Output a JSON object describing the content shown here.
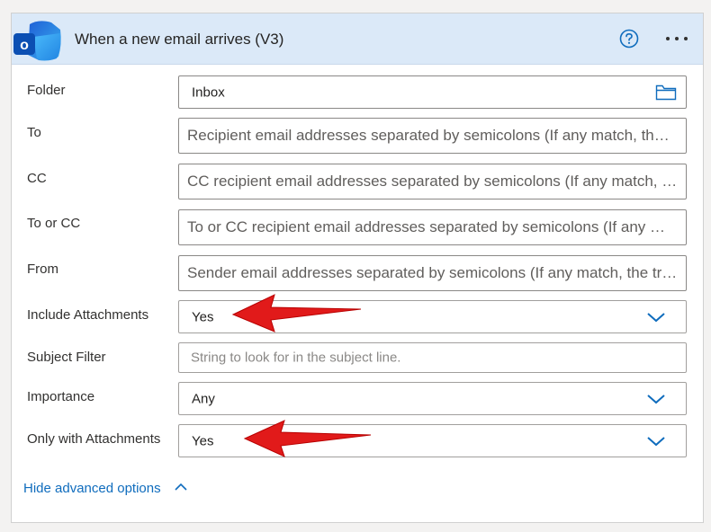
{
  "header": {
    "title": "When a new email arrives (V3)",
    "help_icon": "question-circle-icon",
    "more_icon": "ellipsis-icon",
    "logo_icon": "outlook-logo-icon"
  },
  "fields": {
    "folder": {
      "label": "Folder",
      "value": "Inbox",
      "icon": "folder-icon"
    },
    "to": {
      "label": "To",
      "placeholder": "Recipient email addresses separated by semicolons (If any match, the trigger will run)"
    },
    "cc": {
      "label": "CC",
      "placeholder": "CC recipient email addresses separated by semicolons (If any match, the trigger will run)"
    },
    "to_or_cc": {
      "label": "To or CC",
      "placeholder": "To or CC recipient email addresses separated by semicolons (If any match, the trigger will run)"
    },
    "from": {
      "label": "From",
      "placeholder": "Sender email addresses separated by semicolons (If any match, the trigger will run)"
    },
    "include_attachments": {
      "label": "Include Attachments",
      "value": "Yes"
    },
    "subject_filter": {
      "label": "Subject Filter",
      "placeholder": "String to look for in the subject line."
    },
    "importance": {
      "label": "Importance",
      "value": "Any"
    },
    "only_with_attachments": {
      "label": "Only with Attachments",
      "value": "Yes"
    }
  },
  "advanced": {
    "hide_label": "Hide advanced options"
  },
  "colors": {
    "accent": "#0f6cbd",
    "header_bg": "#dbe9f8",
    "arrow": "#e11a1a"
  }
}
